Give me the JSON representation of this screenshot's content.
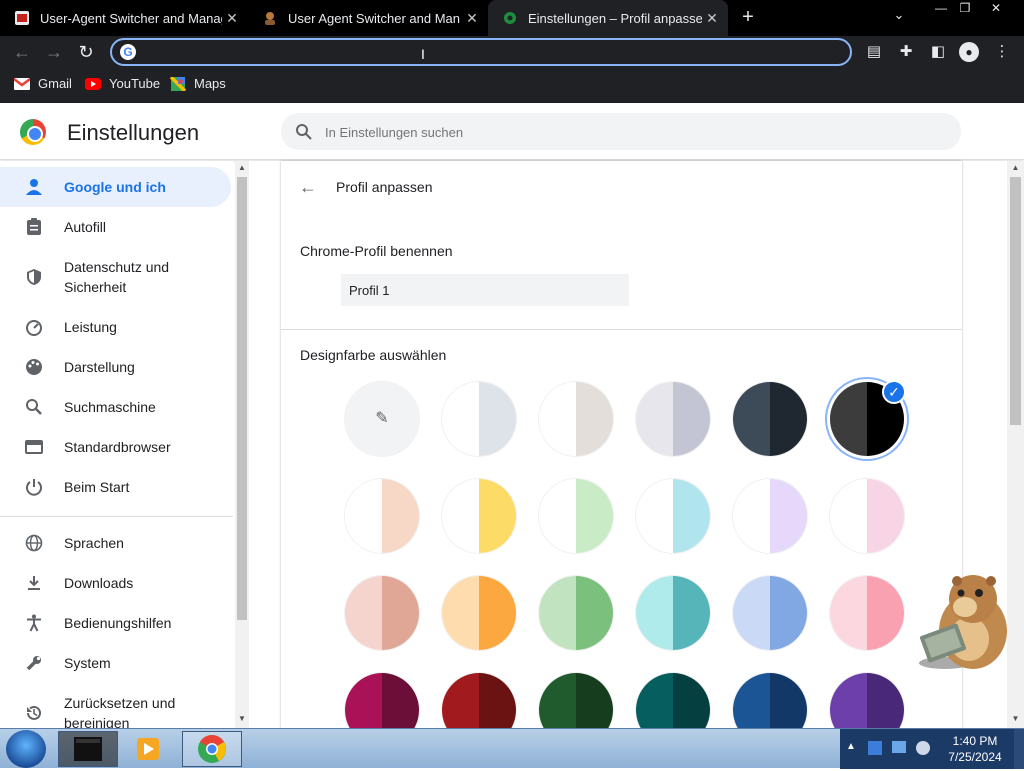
{
  "browser": {
    "tabs": [
      {
        "title": "User-Agent Switcher and Manag"
      },
      {
        "title": "User Agent Switcher and Man"
      },
      {
        "title": "Einstellungen – Profil anpassen"
      }
    ],
    "new_tab_label": "+",
    "omnibox_value": "",
    "bookmarks": [
      {
        "label": "Gmail"
      },
      {
        "label": "YouTube"
      },
      {
        "label": "Maps"
      }
    ]
  },
  "settings": {
    "app_title": "Einstellungen",
    "search_placeholder": "In Einstellungen suchen",
    "sidebar": [
      {
        "label": "Google und ich",
        "icon": "person-icon"
      },
      {
        "label": "Autofill",
        "icon": "clipboard-icon"
      },
      {
        "label": "Datenschutz und Sicherheit",
        "icon": "shield-icon"
      },
      {
        "label": "Leistung",
        "icon": "gauge-icon"
      },
      {
        "label": "Darstellung",
        "icon": "palette-icon"
      },
      {
        "label": "Suchmaschine",
        "icon": "search-icon"
      },
      {
        "label": "Standardbrowser",
        "icon": "browser-icon"
      },
      {
        "label": "Beim Start",
        "icon": "power-icon"
      },
      {
        "label": "Sprachen",
        "icon": "globe-icon"
      },
      {
        "label": "Downloads",
        "icon": "download-icon"
      },
      {
        "label": "Bedienungshilfen",
        "icon": "accessibility-icon"
      },
      {
        "label": "System",
        "icon": "wrench-icon"
      },
      {
        "label": "Zurücksetzen und bereinigen",
        "icon": "history-icon"
      }
    ],
    "page_title": "Profil anpassen",
    "name_section": "Chrome-Profil benennen",
    "profile_name": "Profil 1",
    "color_section": "Designfarbe auswählen",
    "swatches": [
      {
        "left": "#f1f3f4",
        "right": "#f1f3f4",
        "picker": true
      },
      {
        "left": "#ffffff",
        "right": "#dee3e9"
      },
      {
        "left": "#ffffff",
        "right": "#e3ded9"
      },
      {
        "left": "#e6e6ec",
        "right": "#c3c5d3"
      },
      {
        "left": "#3d4a57",
        "right": "#1f2830"
      },
      {
        "left": "#3c3c3c",
        "right": "#000000",
        "selected": true
      },
      {
        "left": "#ffffff",
        "right": "#f7d8c7"
      },
      {
        "left": "#ffffff",
        "right": "#fcdc66"
      },
      {
        "left": "#ffffff",
        "right": "#c9ebc5"
      },
      {
        "left": "#ffffff",
        "right": "#b1e5ed"
      },
      {
        "left": "#ffffff",
        "right": "#e5d8fa"
      },
      {
        "left": "#ffffff",
        "right": "#f8d5e5"
      },
      {
        "left": "#f4d4cd",
        "right": "#e0a696"
      },
      {
        "left": "#fedcae",
        "right": "#fba840"
      },
      {
        "left": "#c2e3c0",
        "right": "#7cc07d"
      },
      {
        "left": "#aeebea",
        "right": "#56b5b9"
      },
      {
        "left": "#cad9f5",
        "right": "#82a8e4"
      },
      {
        "left": "#fdd7e0",
        "right": "#f9a1b0"
      },
      {
        "left": "#aa1257",
        "right": "#6b0e38"
      },
      {
        "left": "#a11a1d",
        "right": "#6b1313"
      },
      {
        "left": "#1f5b2d",
        "right": "#153d1e"
      },
      {
        "left": "#075e5f",
        "right": "#053f40"
      },
      {
        "left": "#1c5596",
        "right": "#113866"
      },
      {
        "left": "#6c3fab",
        "right": "#482877"
      }
    ]
  },
  "taskbar": {
    "time": "1:40 PM",
    "date": "7/25/2024"
  },
  "colors": {
    "accent": "#1a73e8",
    "selected_bg": "#e8f0fe",
    "omnibox_border": "#8ab4f8"
  }
}
